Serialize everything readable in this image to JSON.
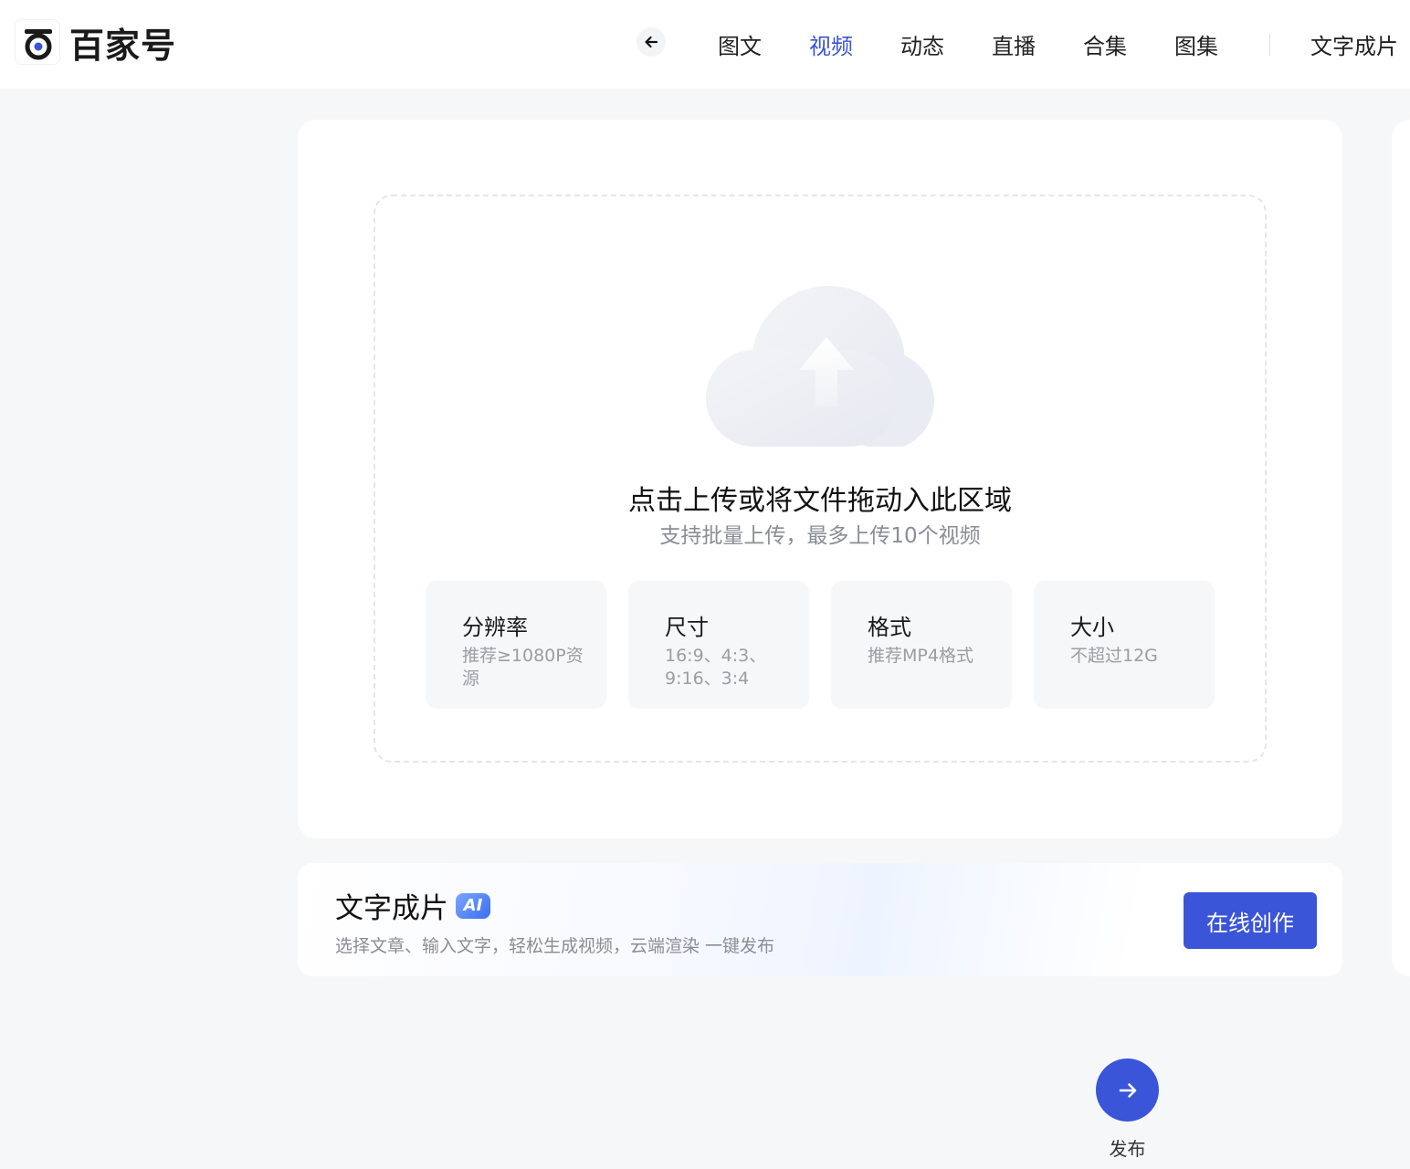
{
  "header": {
    "logo_text": "百家号",
    "nav": [
      {
        "label": "图文"
      },
      {
        "label": "视频",
        "active": true
      },
      {
        "label": "动态"
      },
      {
        "label": "直播"
      },
      {
        "label": "合集"
      },
      {
        "label": "图集"
      }
    ],
    "nav_extra": "文字成片"
  },
  "upload": {
    "title": "点击上传或将文件拖动入此区域",
    "subtitle": "支持批量上传，最多上传10个视频",
    "specs": [
      {
        "title": "分辨率",
        "desc": "推荐≥1080P资源"
      },
      {
        "title": "尺寸",
        "desc": "16:9、4:3、9:16、3:4"
      },
      {
        "title": "格式",
        "desc": "推荐MP4格式"
      },
      {
        "title": "大小",
        "desc": "不超过12G"
      }
    ]
  },
  "ai_section": {
    "title": "文字成片",
    "badge": "AI",
    "desc": "选择文章、输入文字，轻松生成视频，云端渲染 一键发布",
    "button": "在线创作"
  },
  "publish": {
    "label": "发布"
  },
  "colors": {
    "accent": "#3a55d8",
    "background": "#f6f7f9"
  }
}
